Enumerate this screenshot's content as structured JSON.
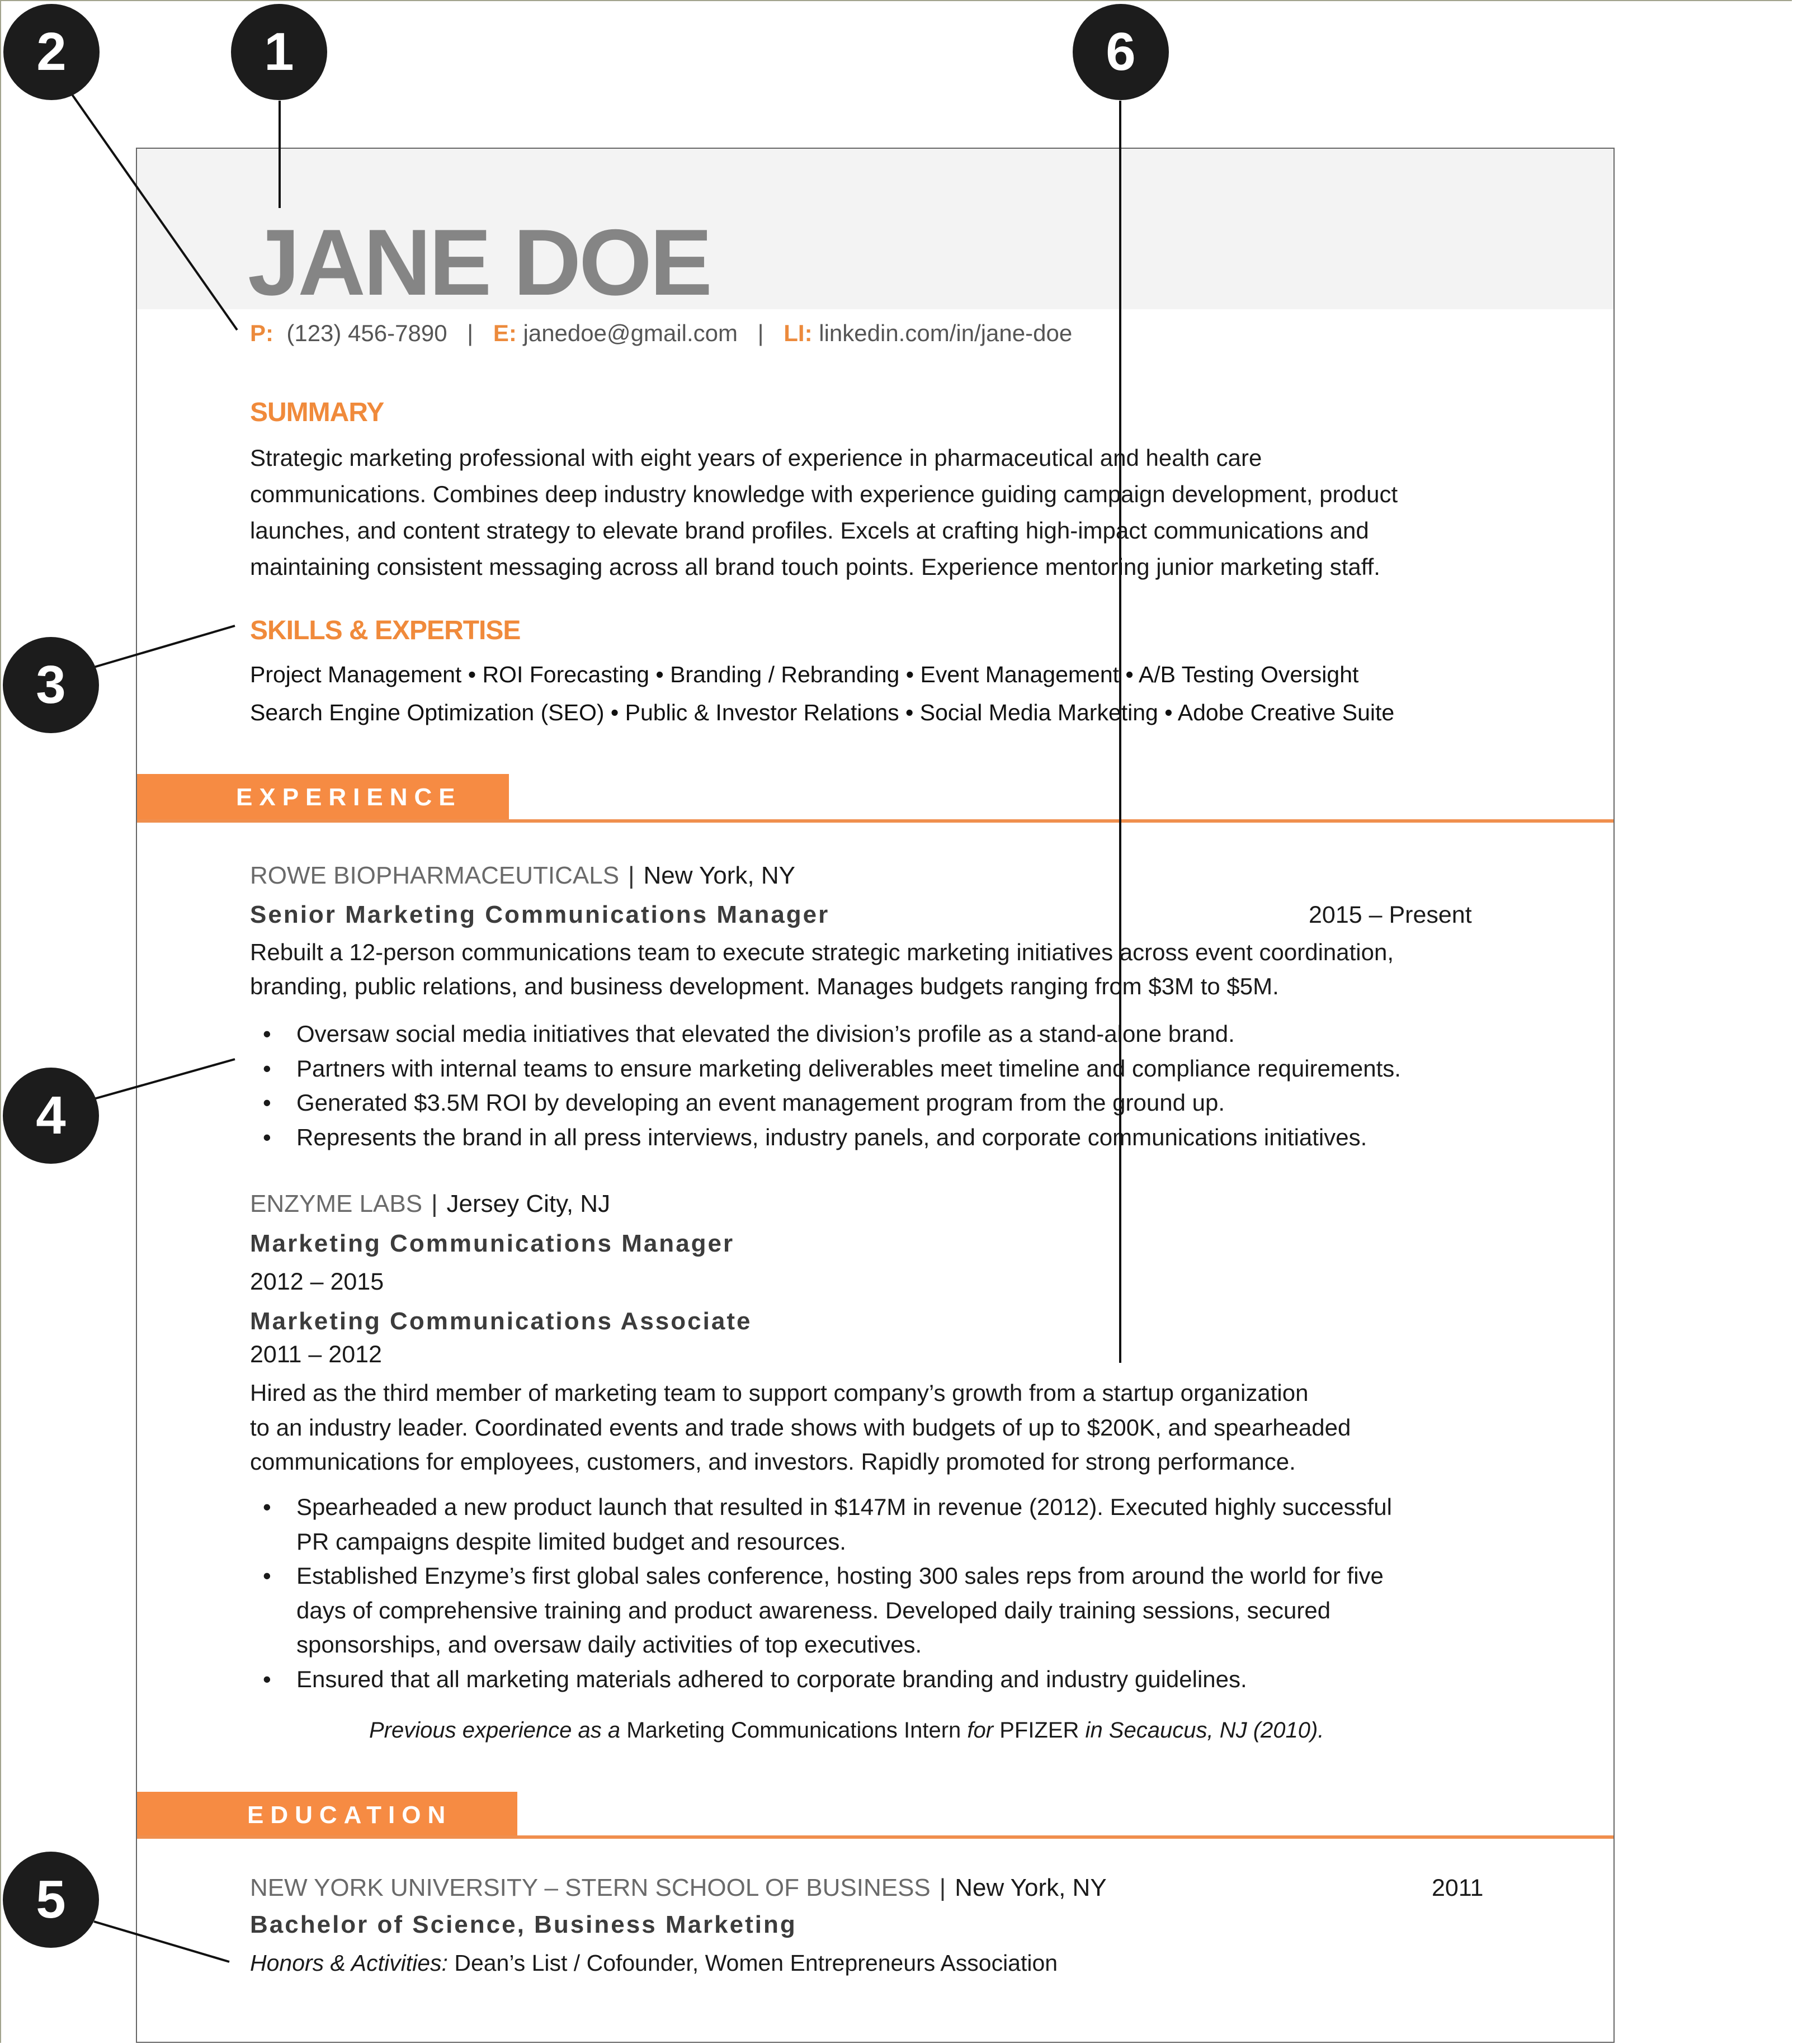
{
  "callouts": [
    "1",
    "2",
    "3",
    "4",
    "5",
    "6"
  ],
  "resume": {
    "name": "JANE DOE",
    "contact": {
      "phone_label": "P:",
      "phone": "(123) 456-7890",
      "email_label": "E:",
      "email": "janedoe@gmail.com",
      "linkedin_label": "LI:",
      "linkedin": "linkedin.com/in/jane-doe",
      "separator": "|"
    },
    "summary": {
      "heading": "SUMMARY",
      "lines": [
        "Strategic marketing professional with eight years of experience in pharmaceutical and health care",
        "communications. Combines deep industry knowledge with experience guiding campaign development, product",
        "launches, and content strategy to elevate brand profiles. Excels at crafting high-impact communications and",
        "maintaining consistent messaging across all brand touch points. Experience mentoring junior marketing staff."
      ]
    },
    "skills": {
      "heading": "SKILLS & EXPERTISE",
      "lines": [
        "Project Management  •  ROI Forecasting  •  Branding / Rebranding  • Event Management  •  A/B Testing Oversight",
        "Search Engine Optimization (SEO)  •  Public & Investor Relations  •  Social Media Marketing  • Adobe Creative Suite"
      ]
    },
    "experience": {
      "heading": "EXPERIENCE",
      "jobs": [
        {
          "company": "ROWE BIOPHARMACEUTICALS",
          "location": "New York, NY",
          "title": "Senior Marketing Communications Manager",
          "dates": "2015 – Present",
          "description": [
            "Rebuilt a 12-person communications team to execute strategic marketing initiatives across event coordination,",
            "branding, public relations, and business development. Manages budgets ranging from $3M to $5M."
          ],
          "bullets": [
            "Oversaw social media initiatives that elevated the division’s profile as a stand-alone brand.",
            "Partners with internal teams to ensure marketing deliverables meet timeline and compliance requirements.",
            "Generated $3.5M ROI by developing an event management program from the ground up.",
            "Represents the brand in all press interviews, industry panels, and corporate communications initiatives."
          ]
        },
        {
          "company": "ENZYME LABS",
          "location": "Jersey City, NJ",
          "title": "Marketing Communications Manager",
          "dates": "2012 – 2015",
          "title2": "Marketing Communications Associate",
          "dates2": "2011 – 2012",
          "description": [
            "Hired as the third member of marketing team to support company’s growth from a startup organization",
            "to an industry leader. Coordinated events and trade shows with budgets of up to $200K, and spearheaded",
            "communications for employees, customers, and investors. Rapidly promoted for strong performance."
          ],
          "bullets": [
            "Spearheaded a new product launch that resulted in $147M in revenue (2012). Executed highly successful",
            "PR campaigns despite limited budget and resources.",
            "Established Enzyme’s first global sales conference, hosting 300 sales reps from around the world for five",
            "days of comprehensive training and product awareness. Developed daily training sessions, secured",
            "sponsorships, and oversaw daily activities of top executives.",
            "Ensured that all marketing materials adhered to corporate branding and industry guidelines."
          ]
        }
      ],
      "previous": {
        "prefix": "Previous experience as a ",
        "role": "Marketing Communications Intern",
        "mid": " for ",
        "company": "PFIZER",
        "suffix": " in Secaucus, NJ (2010)."
      }
    },
    "education": {
      "heading": "EDUCATION",
      "school": "NEW YORK UNIVERSITY – STERN SCHOOL OF BUSINESS",
      "location": "New York, NY",
      "year": "2011",
      "degree": "Bachelor of Science, Business Marketing",
      "honors_label": "Honors & Activities:",
      "honors": " Dean’s List / Cofounder, Women Entrepreneurs Association"
    }
  },
  "colors": {
    "accent": "#f68b43",
    "name_gray": "#858585",
    "callout": "#1c1c1c"
  }
}
